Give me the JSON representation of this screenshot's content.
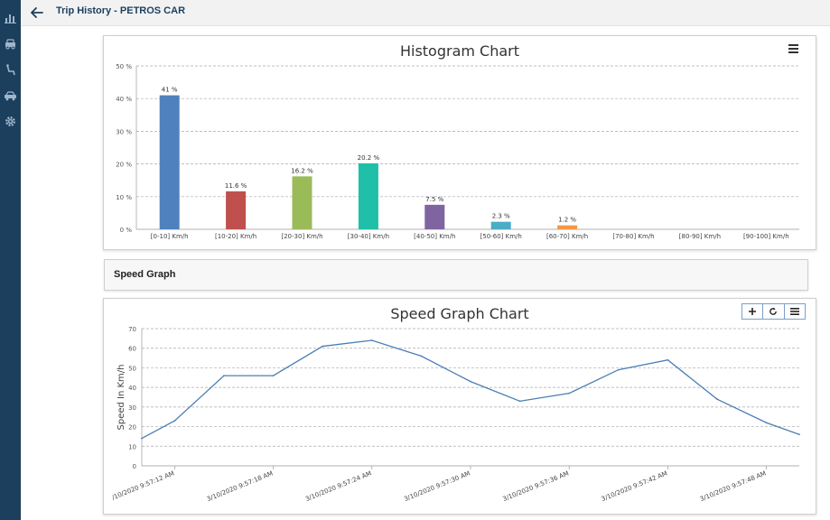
{
  "header": {
    "title": "Trip History - PETROS CAR"
  },
  "sidebar": {
    "items": [
      {
        "icon": "bar-chart-icon"
      },
      {
        "icon": "car-icon"
      },
      {
        "icon": "seat-icon"
      },
      {
        "icon": "vehicle-icon"
      },
      {
        "icon": "gear-icon"
      }
    ]
  },
  "histogram": {
    "title": "Histogram Chart",
    "menu_icon": "hamburger-menu-icon"
  },
  "speed_section": {
    "label": "Speed Graph"
  },
  "speed_chart": {
    "title": "Speed Graph Chart",
    "tools": [
      "zoom-in-icon",
      "reset-zoom-icon",
      "hamburger-menu-icon"
    ]
  },
  "colors": {
    "sidebar": "#1c3f5e",
    "line": "#4a7fb5"
  },
  "chart_data": [
    {
      "type": "bar",
      "title": "Histogram Chart",
      "categories": [
        "[0-10] Km/h",
        "[10-20] Km/h",
        "[20-30] Km/h",
        "[30-40] Km/h",
        "[40-50] Km/h",
        "[50-60] Km/h",
        "[60-70] Km/h",
        "[70-80] Km/h",
        "[80-90] Km/h",
        "[90-100] Km/h"
      ],
      "values": [
        41,
        11.6,
        16.2,
        20.2,
        7.5,
        2.3,
        1.2,
        0,
        0,
        0
      ],
      "data_labels": [
        "41 %",
        "11.6 %",
        "16.2 %",
        "20.2 %",
        "7.5 %",
        "2.3 %",
        "1.2 %",
        "",
        "",
        ""
      ],
      "bar_colors": [
        "#4f81bd",
        "#c0504d",
        "#9bbb59",
        "#1fbfa8",
        "#8064a2",
        "#4bacc6",
        "#f79646",
        "#4f81bd",
        "#4f81bd",
        "#4f81bd"
      ],
      "y_ticks": [
        "0 %",
        "10 %",
        "20 %",
        "30 %",
        "40 %",
        "50 %"
      ],
      "ylim": [
        0,
        50
      ],
      "grid": true
    },
    {
      "type": "line",
      "title": "Speed Graph Chart",
      "ylabel": "Speed In Km/h",
      "ylim": [
        0,
        70
      ],
      "y_ticks": [
        "0",
        "10",
        "20",
        "30",
        "40",
        "50",
        "60",
        "70"
      ],
      "x_tick_labels": [
        "/10/2020 9:57:12 AM",
        "3/10/2020 9:57:18 AM",
        "3/10/2020 9:57:24 AM",
        "3/10/2020 9:57:30 AM",
        "3/10/2020 9:57:36 AM",
        "3/10/2020 9:57:42 AM",
        "3/10/2020 9:57:48 AM"
      ],
      "x_tick_seconds": [
        12,
        18,
        24,
        30,
        36,
        42,
        48
      ],
      "x_range_seconds": [
        10,
        50
      ],
      "series": [
        {
          "x_seconds": [
            10,
            12,
            15,
            18,
            21,
            24,
            27,
            30,
            33,
            36,
            39,
            42,
            45,
            48,
            50
          ],
          "values": [
            14,
            23,
            46,
            46,
            61,
            64,
            56,
            43,
            33,
            37,
            49,
            54,
            34,
            22,
            16
          ]
        }
      ],
      "grid": true
    }
  ]
}
